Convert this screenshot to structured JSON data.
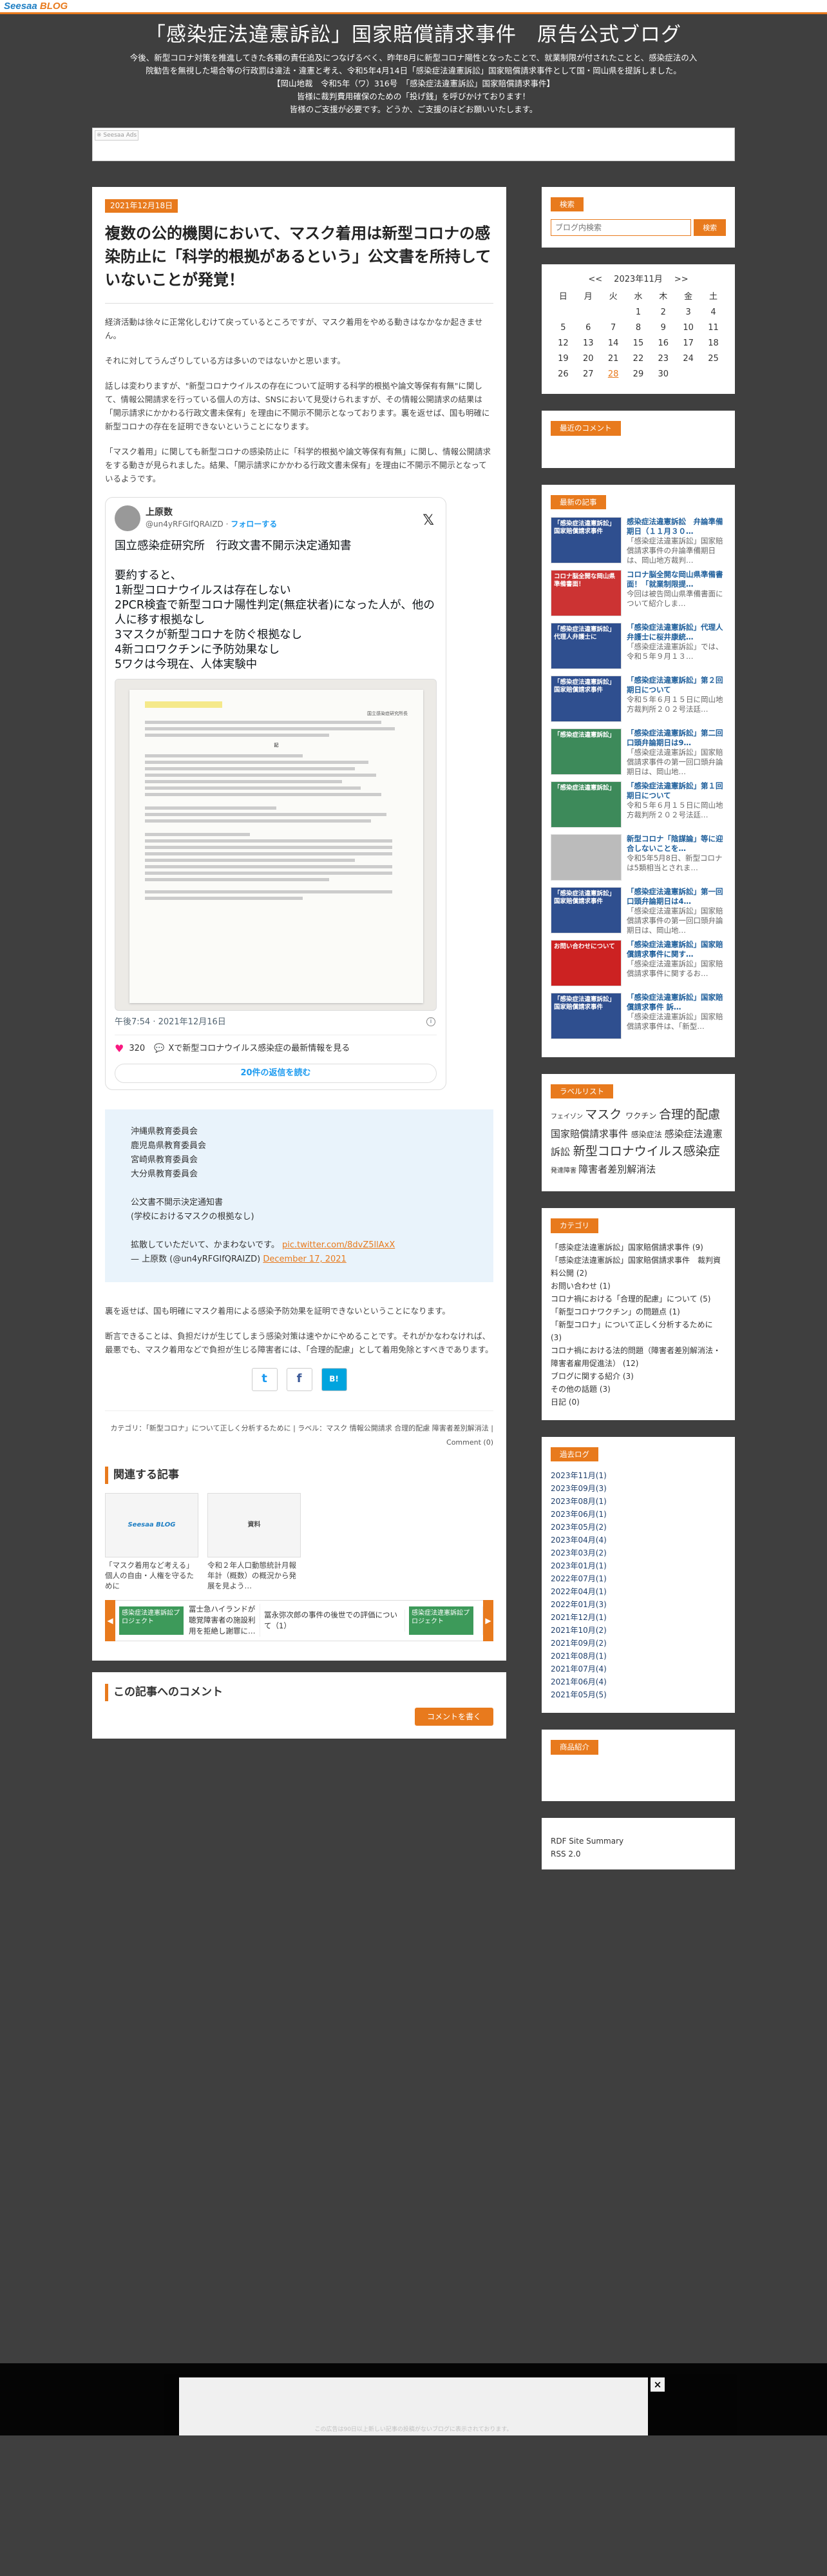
{
  "logo": {
    "a": "Seesaa",
    "b": " BLOG"
  },
  "header": {
    "title": "「感染症法違憲訴訟」国家賠償請求事件　原告公式ブログ",
    "desc": [
      "今後、新型コロナ対策を推進してきた各種の責任追及につなげるべく、昨年8月に新型コロナ陽性となったことで、就業制限が付されたことと、感染症法の入",
      "院勧告を無視した場合等の行政罰は違法・違憲と考え、令和5年4月14日「感染症法違憲訴訟」国家賠償請求事件として国・岡山県を提訴しました。",
      "【岡山地裁　令和5年（ワ）316号　「感染症法違憲訴訟」国家賠償請求事件】",
      "皆様に裁判費用確保のための「投げ銭」を呼びかけております！",
      "皆様のご支援が必要です。どうか、ご支援のほどお願いいたします。"
    ]
  },
  "ad_label": "※ Seesaa Ads",
  "post": {
    "date": "2021年12月18日",
    "title": "複数の公的機関において、マスク着用は新型コロナの感染防止に「科学的根拠があるという」公文書を所持していないことが発覚！",
    "paragraphs": [
      "経済活動は徐々に正常化しむけて戻っているところですが、マスク着用をやめる動きはなかなか起きません。",
      "それに対してうんざりしている方は多いのではないかと思います。",
      "話しは変わりますが、\"新型コロナウイルスの存在について証明する科学的根拠や論文等保有有無\"に関して、情報公開請求を行っている個人の方は、SNSにおいて見受けられますが、その情報公開請求の結果は「開示請求にかかわる行政文書未保有」を理由に不開示不開示となっております。裏を返せば、国も明確に新型コロナの存在を証明できないということになります。",
      "「マスク着用」に関しても新型コロナの感染防止に「科学的根拠や論文等保有有無」に関し、情報公開請求をする動きが見られました。結果、「開示請求にかかわる行政文書未保有」を理由に不開示不開示となっているようです。"
    ],
    "after": [
      "裏を返せば、国も明確にマスク着用による感染予防効果を証明できないということになります。",
      "断言できることは、負担だけが生じてしまう感染対策は速やかにやめることです。それがかなわなければ、最悪でも、マスク着用などで負担が生じる障害者には、「合理的配慮」として着用免除とすべきであります。"
    ]
  },
  "tweet": {
    "name": "上原数",
    "handle": "@un4yRFGIfQRAIZD",
    "follow": "フォローする",
    "text": [
      "国立感染症研究所　行政文書不開示決定通知書",
      "",
      "要約すると、",
      "1新型コロナウイルスは存在しない",
      "2PCR検査で新型コロナ陽性判定(無症状者)になった人が、他の人に移す根拠なし",
      "3マスクが新型コロナを防ぐ根拠なし",
      "4新コロワクチンに予防効果なし",
      "5ワクは今現在、人体実験中"
    ],
    "doc_org": "国立感染症研究所長",
    "doc_heading": "記",
    "time": "午後7:54 · 2021年12月16日",
    "likes": "320",
    "related": "Xで新型コロナウイルス感染症の最新情報を見る",
    "reply": "20件の返信を読む"
  },
  "quote": {
    "lines": [
      "沖縄県教育委員会",
      "鹿児島県教育委員会",
      "宮崎県教育委員会",
      "大分県教育委員会",
      "",
      "公文書不開示決定通知書",
      "(学校におけるマスクの根拠なし)",
      "",
      "拡散していただいて、かまわないです。"
    ],
    "link": "pic.twitter.com/8dvZ5llAxX",
    "byline": "— 上原数 (@un4yRFGIfQRAIZD)",
    "date": "December 17, 2021"
  },
  "share": {
    "tw": "t",
    "fb": "f",
    "hb": "B!"
  },
  "category_line": "カテゴリ：「新型コロナ」について正しく分析するために",
  "labels_line": "ラベル：マスク 情報公開請求 合理的配慮 障害者差別解消法",
  "comment_link": "Comment (0)",
  "related": {
    "heading": "関連する記事",
    "items": [
      {
        "thumb": "Seesaa BLOG",
        "text": "「マスク着用など考える」個人の自由・人権を守るために"
      },
      {
        "thumb": "資料",
        "text": "令和２年人口動態統計月報年計（概数）の概況から発展を見よう…"
      }
    ],
    "slides": [
      {
        "thumb": "感染症法違憲訴訟プロジェクト",
        "text": "冨士急ハイランドが聴覚障害者の施設利用を拒絶し謝罪に…"
      },
      {
        "thumb": "",
        "text": "冨永弥次郎の事件の後世での評価について（1）"
      },
      {
        "thumb": "感染症法違憲訴訟プロジェクト",
        "text": ""
      }
    ]
  },
  "comment": {
    "heading": "この記事へのコメント",
    "button": "コメントを書く"
  },
  "side": {
    "search": {
      "title": "検索",
      "placeholder": "ブログ内検索",
      "button": "検索"
    },
    "calendar": {
      "prev": "<<",
      "month": "2023年11月",
      "next": ">>",
      "dow": [
        "日",
        "月",
        "火",
        "水",
        "木",
        "金",
        "土"
      ],
      "rows": [
        [
          "",
          "",
          "",
          "1",
          "2",
          "3",
          "4"
        ],
        [
          "5",
          "6",
          "7",
          "8",
          "9",
          "10",
          "11"
        ],
        [
          "12",
          "13",
          "14",
          "15",
          "16",
          "17",
          "18"
        ],
        [
          "19",
          "20",
          "21",
          "22",
          "23",
          "24",
          "25"
        ],
        [
          "26",
          "27",
          "28",
          "29",
          "30",
          "",
          ""
        ]
      ],
      "today": "28"
    },
    "recent_comments": {
      "title": "最近のコメント"
    },
    "latest": {
      "title": "最新の記事",
      "items": [
        {
          "thumb": "「感染症法違憲訴訟」国家賠償請求事件",
          "title": "感染症法違憲訴訟　弁論準備期日（１１月３０…",
          "desc": "「感染症法違憲訴訟」国家賠償請求事件の弁論準備期日は、岡山地方裁判…",
          "color": "#2f4f8f"
        },
        {
          "thumb": "コロナ脳全開な岡山県準備書面！",
          "title": "コロナ脳全開な岡山県準備書面！「就業制限提…",
          "desc": "今回は被告岡山県準備書面について紹介しま…",
          "color": "#cc3333"
        },
        {
          "thumb": "「感染症法違憲訴訟」代理人弁護士に",
          "title": "「感染症法違憲訴訟」代理人弁護士に桜井康統…",
          "desc": "「感染症法違憲訴訟」では、令和５年９月１３…",
          "color": "#2f4f8f"
        },
        {
          "thumb": "「感染症法違憲訴訟」国家賠償請求事件",
          "title": "「感染症法違憲訴訟」第２回期日について",
          "desc": "令和５年６月１５日に岡山地方裁判所２０２号法廷…",
          "color": "#2f4f8f"
        },
        {
          "thumb": "「感染症法違憲訴訟」",
          "title": "「感染症法違憲訴訟」第二回口頭弁論期日は9…",
          "desc": "「感染症法違憲訴訟」国家賠償請求事件の第一回口頭弁論期日は、岡山地…",
          "color": "#3d8a5a"
        },
        {
          "thumb": "「感染症法違憲訴訟」",
          "title": "「感染症法違憲訴訟」第１回期日について",
          "desc": "令和５年６月１５日に岡山地方裁判所２０２号法廷…",
          "color": "#3d8a5a"
        },
        {
          "thumb": "",
          "title": "新型コロナ「陰謀論」等に迎合しないことを…",
          "desc": "令和5年5月8日、新型コロナは5類相当とされま…",
          "color": "#bbbbbb"
        },
        {
          "thumb": "「感染症法違憲訴訟」国家賠償請求事件",
          "title": "「感染症法違憲訴訟」第一回口頭弁論期日は4…",
          "desc": "「感染症法違憲訴訟」国家賠償請求事件の第一回口頭弁論期日は、岡山地…",
          "color": "#2f4f8f"
        },
        {
          "thumb": "お問い合わせについて",
          "title": "「感染症法違憲訴訟」国家賠償請求事件に関す…",
          "desc": "「感染症法違憲訴訟」国家賠償請求事件に関するお…",
          "color": "#cc2222"
        },
        {
          "thumb": "「感染症法違憲訴訟」国家賠償請求事件",
          "title": "「感染症法違憲訴訟」国家賠償請求事件 訴…",
          "desc": "「感染症法違憲訴訟」国家賠償請求事件は、「新型…",
          "color": "#2f4f8f"
        }
      ]
    },
    "labels": {
      "title": "ラベルリスト",
      "tags": [
        {
          "t": "フェイゾン",
          "s": 10
        },
        {
          "t": "マスク",
          "s": 19
        },
        {
          "t": "ワクチン",
          "s": 12
        },
        {
          "t": "合理的配慮",
          "s": 19
        },
        {
          "t": "国家賠償請求事件",
          "s": 15
        },
        {
          "t": "感染症法",
          "s": 12
        },
        {
          "t": "感染症法違憲訴訟",
          "s": 15
        },
        {
          "t": "新型コロナウイルス感染症",
          "s": 19
        },
        {
          "t": "発達障害",
          "s": 10
        },
        {
          "t": "障害者差別解消法",
          "s": 15
        }
      ]
    },
    "categories": {
      "title": "カテゴリ",
      "items": [
        "「感染症法違憲訴訟」国家賠償請求事件 (9)",
        "「感染症法違憲訴訟」国家賠償請求事件　裁判資料公開 (2)",
        "お問い合わせ (1)",
        "コロナ禍における「合理的配慮」について (5)",
        "「新型コロナワクチン」の問題点 (1)",
        "「新型コロナ」について正しく分析するために (3)",
        "コロナ禍における法的問題（障害者差別解消法・障害者雇用促進法） (12)",
        "ブログに関する紹介 (3)",
        "その他の話題 (3)",
        "日記 (0)"
      ]
    },
    "archive": {
      "title": "過去ログ",
      "items": [
        "2023年11月(1)",
        "2023年09月(3)",
        "2023年08月(1)",
        "2023年06月(1)",
        "2023年05月(2)",
        "2023年04月(4)",
        "2023年03月(2)",
        "2023年01月(1)",
        "2022年07月(1)",
        "2022年04月(1)",
        "2022年01月(3)",
        "2021年12月(1)",
        "2021年10月(2)",
        "2021年09月(2)",
        "2021年08月(1)",
        "2021年07月(4)",
        "2021年06月(4)",
        "2021年05月(5)"
      ]
    },
    "goods": {
      "title": "商品紹介"
    },
    "links": [
      "RDF Site Summary",
      "RSS 2.0"
    ]
  },
  "float_ad": {
    "close": "×",
    "note": "この広告は90日以上新しい記事の投稿がないブログに表示されております。"
  }
}
